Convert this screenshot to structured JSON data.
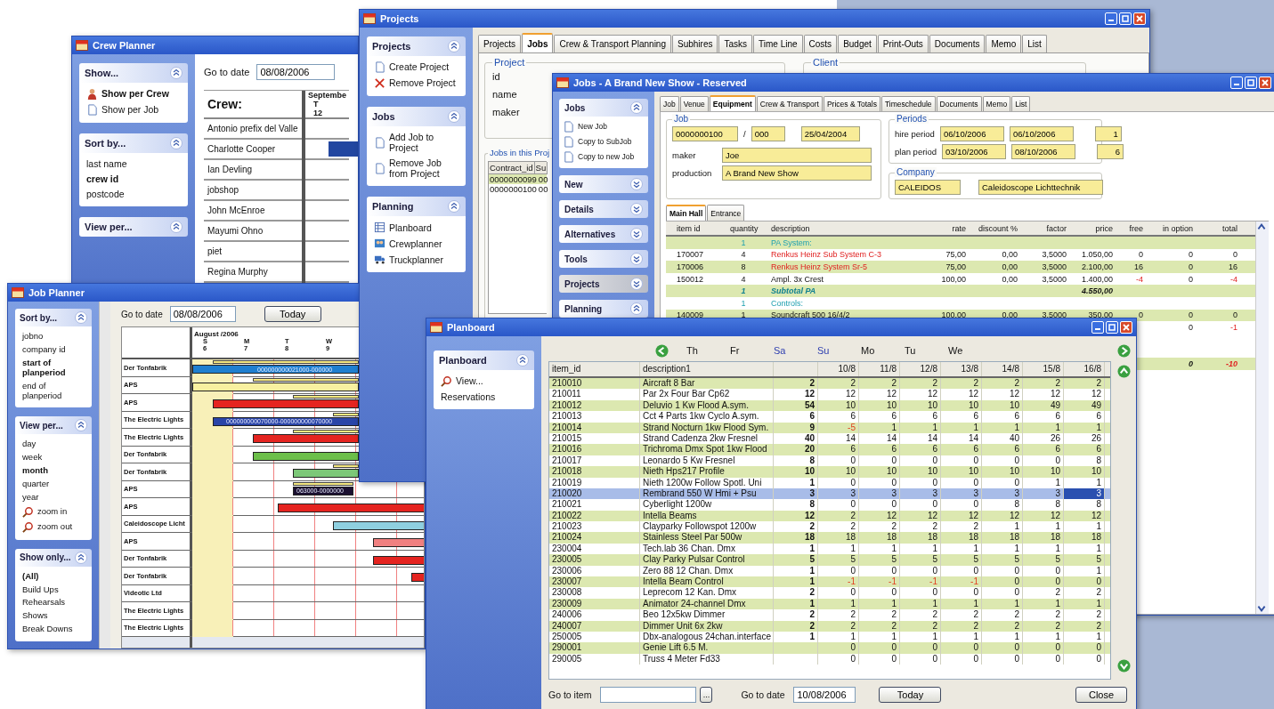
{
  "crew_planner": {
    "title": "Crew Planner",
    "panels": [
      {
        "title": "Show...",
        "expanded": true,
        "items": [
          {
            "label": "Show per Crew",
            "selected": true
          },
          {
            "label": "Show per Job",
            "selected": false
          }
        ]
      },
      {
        "title": "Sort by...",
        "expanded": true,
        "items": [
          {
            "label": "last name",
            "selected": false
          },
          {
            "label": "crew id",
            "selected": true
          },
          {
            "label": "postcode",
            "selected": false
          }
        ]
      },
      {
        "title": "View per...",
        "expanded": true
      }
    ],
    "goto_label": "Go to date",
    "goto_value": "08/08/2006",
    "crew_header": "Crew:",
    "month": "Septembe",
    "weekday": "T",
    "day": "12",
    "crew": [
      {
        "name": "Antonio prefix del Valle",
        "booked": false
      },
      {
        "name": "Charlotte Cooper",
        "booked": true
      },
      {
        "name": "Ian Devling",
        "booked": false
      },
      {
        "name": "jobshop",
        "booked": false
      },
      {
        "name": "John McEnroe",
        "booked": false
      },
      {
        "name": "Mayumi Ohno",
        "booked": false
      },
      {
        "name": "piet",
        "booked": false
      },
      {
        "name": "Regina Murphy",
        "booked": false
      }
    ]
  },
  "job_planner": {
    "title": "Job Planner",
    "panels": [
      {
        "title": "Sort by...",
        "expanded": true,
        "items": [
          {
            "label": "jobno",
            "selected": false
          },
          {
            "label": "company id",
            "selected": false
          },
          {
            "label": "start of planperiod",
            "selected": true
          },
          {
            "label": "end of planperiod",
            "selected": false
          }
        ]
      },
      {
        "title": "View per...",
        "expanded": true,
        "items": [
          {
            "label": "day",
            "selected": false
          },
          {
            "label": "week",
            "selected": false
          },
          {
            "label": "month",
            "selected": true
          },
          {
            "label": "quarter",
            "selected": false
          },
          {
            "label": "year",
            "selected": false
          },
          {
            "label": "zoom in",
            "selected": false
          },
          {
            "label": "zoom out",
            "selected": false
          }
        ]
      },
      {
        "title": "Show only...",
        "expanded": true,
        "items": [
          {
            "label": "(All)",
            "selected": true
          },
          {
            "label": "Build Ups",
            "selected": false
          },
          {
            "label": "Rehearsals",
            "selected": false
          },
          {
            "label": "Shows",
            "selected": false
          },
          {
            "label": "Break Downs",
            "selected": false
          }
        ]
      }
    ],
    "goto_label": "Go to date",
    "goto_value": "08/08/2006",
    "today_button": "Today",
    "month": "August /2006",
    "days": [
      {
        "letter": "S",
        "date": "6"
      },
      {
        "letter": "M",
        "date": "7"
      },
      {
        "letter": "T",
        "date": "8"
      },
      {
        "letter": "W",
        "date": "9"
      }
    ],
    "rows": [
      {
        "company": "Der Tonfabrik",
        "bar": {
          "color": "#1f7fd0",
          "label": "000000000021000-000000"
        }
      },
      {
        "company": "APS",
        "bar": {
          "color": "#f8f0a0"
        }
      },
      {
        "company": "APS",
        "bar": {
          "color": "#e52420"
        }
      },
      {
        "company": "The Electric Lights",
        "bar": {
          "color": "#2a45a8",
          "label": "000000000070000-000000000070000"
        }
      },
      {
        "company": "The Electric Lights",
        "bar": {
          "color": "#e52420"
        }
      },
      {
        "company": "Der Tonfabrik",
        "bar": {
          "color": "#6cbf4a"
        }
      },
      {
        "company": "Der Tonfabrik",
        "bar": {
          "color": "#7cc878"
        }
      },
      {
        "company": "APS",
        "bar": {
          "color": "#1a1030",
          "label": "063000-0000000"
        }
      },
      {
        "company": "APS",
        "bar": {
          "color": "#e52420"
        }
      },
      {
        "company": "Caleidoscope Licht",
        "bar": {
          "color": "#8fd0e0"
        }
      },
      {
        "company": "APS",
        "bar": {
          "color": "#f08080"
        }
      },
      {
        "company": "Der Tonfabrik",
        "bar": {
          "color": "#e52420"
        }
      },
      {
        "company": "Der Tonfabrik",
        "bar": {
          "color": "#e52420"
        }
      },
      {
        "company": "Videotic Ltd"
      },
      {
        "company": "The Electric Lights"
      },
      {
        "company": "The Electric Lights"
      }
    ]
  },
  "projects": {
    "title": "Projects",
    "panels": [
      {
        "title": "Projects",
        "expanded": true,
        "items": [
          {
            "label": "Create Project"
          },
          {
            "label": "Remove Project"
          }
        ]
      },
      {
        "title": "Jobs",
        "expanded": true,
        "items": [
          {
            "label": "Add Job to Project"
          },
          {
            "label": "Remove Job from Project"
          }
        ]
      },
      {
        "title": "Planning",
        "expanded": true,
        "items": [
          {
            "label": "Planboard"
          },
          {
            "label": "Crewplanner"
          },
          {
            "label": "Truckplanner"
          }
        ]
      }
    ],
    "tabs": [
      {
        "label": "Projects",
        "selected": false
      },
      {
        "label": "Jobs",
        "selected": true
      },
      {
        "label": "Crew & Transport Planning",
        "selected": false
      },
      {
        "label": "Subhires",
        "selected": false
      },
      {
        "label": "Tasks",
        "selected": false
      },
      {
        "label": "Time Line",
        "selected": false
      },
      {
        "label": "Costs",
        "selected": false
      },
      {
        "label": "Budget",
        "selected": false
      },
      {
        "label": "Print-Outs",
        "selected": false
      },
      {
        "label": "Documents",
        "selected": false
      },
      {
        "label": "Memo",
        "selected": false
      },
      {
        "label": "List",
        "selected": false
      }
    ],
    "project_group": "Project",
    "client_group": "Client",
    "fields": [
      "id",
      "name",
      "maker"
    ],
    "jobs_group": "Jobs in this Proj",
    "jobs_columns": [
      "Contract_id",
      "Su"
    ],
    "jobs_rows": [
      [
        "0000000099",
        "00"
      ],
      [
        "0000000100",
        "00"
      ]
    ]
  },
  "jobs": {
    "title": "Jobs - A Brand New Show - Reserved",
    "panels": [
      {
        "title": "Jobs",
        "expanded": true,
        "selected": false,
        "items": [
          {
            "label": "New Job"
          },
          {
            "label": "Copy to SubJob"
          },
          {
            "label": "Copy to new Job"
          }
        ]
      },
      {
        "title": "New",
        "expanded": false,
        "selected": false
      },
      {
        "title": "Details",
        "expanded": false,
        "selected": false
      },
      {
        "title": "Alternatives",
        "expanded": false,
        "selected": false
      },
      {
        "title": "Tools",
        "expanded": false,
        "selected": false
      },
      {
        "title": "Projects",
        "expanded": false,
        "selected": true
      },
      {
        "title": "Planning",
        "expanded": true,
        "selected": false
      }
    ],
    "tabs": [
      {
        "label": "Job",
        "selected": false
      },
      {
        "label": "Venue",
        "selected": false
      },
      {
        "label": "Equipment",
        "selected": true
      },
      {
        "label": "Crew & Transport",
        "selected": false
      },
      {
        "label": "Prices & Totals",
        "selected": false
      },
      {
        "label": "Timeschedule",
        "selected": false
      },
      {
        "label": "Documents",
        "selected": false
      },
      {
        "label": "Memo",
        "selected": false
      },
      {
        "label": "List",
        "selected": false
      }
    ],
    "job_group": "Job",
    "job_no": "0000000100",
    "slash": "/",
    "sub_no": "000",
    "date": "25/04/2004",
    "maker_label": "maker",
    "maker": "Joe",
    "production_label": "production",
    "production": "A Brand New Show",
    "periods_group": "Periods",
    "periods": [
      {
        "label": "hire period",
        "from": "06/10/2006",
        "to": "06/10/2006",
        "days": "1"
      },
      {
        "label": "plan period",
        "from": "03/10/2006",
        "to": "08/10/2006",
        "days": "6"
      }
    ],
    "company_group": "Company",
    "company_code": "CALEIDOS",
    "company_name": "Caleidoscope Lichttechnik",
    "subtabs": [
      {
        "label": "Main Hall",
        "selected": true
      },
      {
        "label": "Entrance",
        "selected": false
      }
    ],
    "columns": [
      "item id",
      "quantity",
      "description",
      "rate",
      "discount %",
      "factor",
      "price",
      "free",
      "in option",
      "total"
    ],
    "rows": [
      {
        "kind": "group",
        "quantity": "1",
        "description": "PA System:"
      },
      {
        "kind": "item",
        "item_id": "170007",
        "quantity": "4",
        "description": "Renkus Heinz Sub System C-3",
        "rate": "75,00",
        "discount": "0,00",
        "factor": "3,5000",
        "price": "1.050,00",
        "free": "0",
        "in_option": "0",
        "total": "0"
      },
      {
        "kind": "item",
        "item_id": "170006",
        "quantity": "8",
        "description": "Renkus Heinz System Sr-5",
        "rate": "75,00",
        "discount": "0,00",
        "factor": "3,5000",
        "price": "2.100,00",
        "free": "16",
        "in_option": "0",
        "total": "16"
      },
      {
        "kind": "item",
        "item_id": "150012",
        "quantity": "4",
        "description": "Ampl. 3x Crest",
        "rate": "100,00",
        "discount": "0,00",
        "factor": "3,5000",
        "price": "1.400,00",
        "free": "-4",
        "in_option": "0",
        "total": "-4"
      },
      {
        "kind": "subtotal",
        "quantity": "1",
        "description": "Subtotal PA",
        "price": "4.550,00"
      },
      {
        "kind": "group",
        "quantity": "1",
        "description": "Controls:"
      },
      {
        "kind": "item",
        "item_id": "140009",
        "quantity": "1",
        "description": "Soundcraft 500 16/4/2",
        "rate": "100,00",
        "discount": "0,00",
        "factor": "3,5000",
        "price": "350,00",
        "free": "0",
        "in_option": "0",
        "total": "0"
      },
      {
        "kind": "item",
        "in_option": "0",
        "total": "-1"
      },
      {
        "kind": "group"
      },
      {
        "kind": "item"
      },
      {
        "kind": "subtotal",
        "in_option": "0",
        "total": "-10"
      }
    ]
  },
  "planboard": {
    "title": "Planboard",
    "panels": [
      {
        "title": "Planboard",
        "expanded": true,
        "items": [
          {
            "label": "View..."
          },
          {
            "label": "Reservations"
          }
        ]
      }
    ],
    "weekdays": [
      {
        "label": "Th",
        "weekend": false
      },
      {
        "label": "Fr",
        "weekend": false
      },
      {
        "label": "Sa",
        "weekend": true
      },
      {
        "label": "Su",
        "weekend": true
      },
      {
        "label": "Mo",
        "weekend": false
      },
      {
        "label": "Tu",
        "weekend": false
      },
      {
        "label": "We",
        "weekend": false
      }
    ],
    "columns": [
      "item_id",
      "description1",
      "10/8",
      "11/8",
      "12/8",
      "13/8",
      "14/8",
      "15/8",
      "16/8"
    ],
    "rows": [
      {
        "item_id": "210010",
        "description": "Aircraft 8 Bar",
        "stock": "2",
        "days": [
          "2",
          "2",
          "2",
          "2",
          "2",
          "2",
          "2"
        ],
        "selected": false
      },
      {
        "item_id": "210011",
        "description": "Par 2x Four Bar Cp62",
        "stock": "12",
        "days": [
          "12",
          "12",
          "12",
          "12",
          "12",
          "12",
          "12"
        ],
        "selected": false
      },
      {
        "item_id": "210012",
        "description": "Deluvio 1 Kw Flood A.sym.",
        "stock": "54",
        "days": [
          "10",
          "10",
          "10",
          "10",
          "10",
          "49",
          "49"
        ],
        "selected": false
      },
      {
        "item_id": "210013",
        "description": "Cct 4 Parts 1kw Cyclo A.sym.",
        "stock": "6",
        "days": [
          "6",
          "6",
          "6",
          "6",
          "6",
          "6",
          "6"
        ],
        "selected": false
      },
      {
        "item_id": "210014",
        "description": "Strand Nocturn 1kw Flood Sym.",
        "stock": "9",
        "days": [
          "-5",
          "1",
          "1",
          "1",
          "1",
          "1",
          "1"
        ],
        "selected": false
      },
      {
        "item_id": "210015",
        "description": "Strand Cadenza 2kw Fresnel",
        "stock": "40",
        "days": [
          "14",
          "14",
          "14",
          "14",
          "40",
          "26",
          "26"
        ],
        "selected": false
      },
      {
        "item_id": "210016",
        "description": "Trichroma Dmx Spot 1kw Flood",
        "stock": "20",
        "days": [
          "6",
          "6",
          "6",
          "6",
          "6",
          "6",
          "6"
        ],
        "selected": false
      },
      {
        "item_id": "210017",
        "description": "Leonardo 5 Kw Fresnel",
        "stock": "8",
        "days": [
          "0",
          "0",
          "0",
          "0",
          "0",
          "0",
          "8"
        ],
        "selected": false
      },
      {
        "item_id": "210018",
        "description": "Nieth Hps217 Profile",
        "stock": "10",
        "days": [
          "10",
          "10",
          "10",
          "10",
          "10",
          "10",
          "10"
        ],
        "selected": false
      },
      {
        "item_id": "210019",
        "description": "Nieth 1200w Follow Spotl. Uni",
        "stock": "1",
        "days": [
          "0",
          "0",
          "0",
          "0",
          "0",
          "1",
          "1"
        ],
        "selected": false
      },
      {
        "item_id": "210020",
        "description": "Rembrand 550 W Hmi + Psu",
        "stock": "3",
        "days": [
          "3",
          "3",
          "3",
          "3",
          "3",
          "3",
          "3"
        ],
        "selected": true
      },
      {
        "item_id": "210021",
        "description": "Cyberlight 1200w",
        "stock": "8",
        "days": [
          "0",
          "0",
          "0",
          "0",
          "8",
          "8",
          "8"
        ],
        "selected": false
      },
      {
        "item_id": "210022",
        "description": "Intella Beams",
        "stock": "12",
        "days": [
          "2",
          "12",
          "12",
          "12",
          "12",
          "12",
          "12"
        ],
        "selected": false
      },
      {
        "item_id": "210023",
        "description": "Clayparky Followspot 1200w",
        "stock": "2",
        "days": [
          "2",
          "2",
          "2",
          "2",
          "1",
          "1",
          "1"
        ],
        "selected": false
      },
      {
        "item_id": "210024",
        "description": "Stainless Steel Par 500w",
        "stock": "18",
        "days": [
          "18",
          "18",
          "18",
          "18",
          "18",
          "18",
          "18"
        ],
        "selected": false
      },
      {
        "item_id": "230004",
        "description": "Tech.lab 36 Chan. Dmx",
        "stock": "1",
        "days": [
          "1",
          "1",
          "1",
          "1",
          "1",
          "1",
          "1"
        ],
        "selected": false
      },
      {
        "item_id": "230005",
        "description": "Clay Parky Pulsar Control",
        "stock": "5",
        "days": [
          "5",
          "5",
          "5",
          "5",
          "5",
          "5",
          "5"
        ],
        "selected": false
      },
      {
        "item_id": "230006",
        "description": "Zero 88 12 Chan. Dmx",
        "stock": "1",
        "days": [
          "0",
          "0",
          "0",
          "0",
          "0",
          "0",
          "1"
        ],
        "selected": false
      },
      {
        "item_id": "230007",
        "description": "Intella Beam Control",
        "stock": "1",
        "days": [
          "-1",
          "-1",
          "-1",
          "-1",
          "0",
          "0",
          "0"
        ],
        "selected": false
      },
      {
        "item_id": "230008",
        "description": "Leprecom 12 Kan. Dmx",
        "stock": "2",
        "days": [
          "0",
          "0",
          "0",
          "0",
          "0",
          "2",
          "2"
        ],
        "selected": false
      },
      {
        "item_id": "230009",
        "description": "Animator 24-channel Dmx",
        "stock": "1",
        "days": [
          "1",
          "1",
          "1",
          "1",
          "1",
          "1",
          "1"
        ],
        "selected": false
      },
      {
        "item_id": "240006",
        "description": "Beo 12x5kw Dimmer",
        "stock": "2",
        "days": [
          "2",
          "2",
          "2",
          "2",
          "2",
          "2",
          "2"
        ],
        "selected": false
      },
      {
        "item_id": "240007",
        "description": "Dimmer Unit 6x 2kw",
        "stock": "2",
        "days": [
          "2",
          "2",
          "2",
          "2",
          "2",
          "2",
          "2"
        ],
        "selected": false
      },
      {
        "item_id": "250005",
        "description": "Dbx-analogous 24chan.interface",
        "stock": "1",
        "days": [
          "1",
          "1",
          "1",
          "1",
          "1",
          "1",
          "1"
        ],
        "selected": false
      },
      {
        "item_id": "290001",
        "description": "Genie Lift 6.5 M.",
        "days": [
          "0",
          "0",
          "0",
          "0",
          "0",
          "0",
          "0"
        ],
        "selected": false
      },
      {
        "item_id": "290005",
        "description": "Truss 4 Meter Fd33",
        "days": [
          "0",
          "0",
          "0",
          "0",
          "0",
          "0",
          "0"
        ],
        "selected": false
      }
    ],
    "goto_item_label": "Go to item",
    "browse_button": "...",
    "goto_date_label": "Go to date",
    "goto_date": "10/08/2006",
    "today_button": "Today",
    "close_button": "Close"
  }
}
